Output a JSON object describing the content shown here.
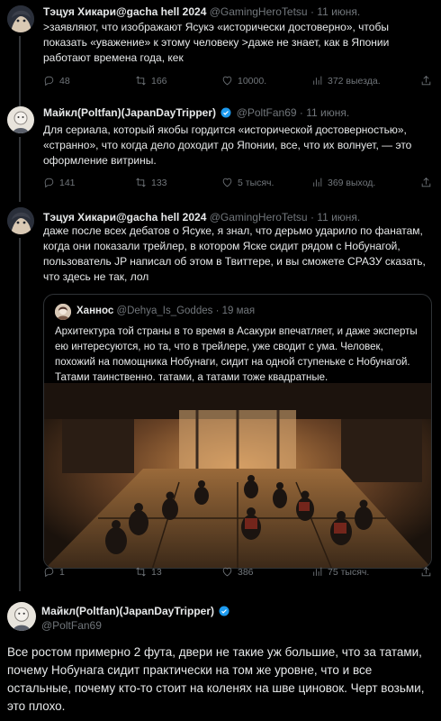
{
  "tweets": [
    {
      "name": "Тэцуя Хикари@gacha hell 2024",
      "handle": "@GamingHeroTetsu",
      "date": "· 11 июня.",
      "text": ">заявляют, что изображают Ясукэ «исторически достоверно», чтобы показать «уважение» к этому человеку >даже не знает, как в Японии работают времена года, кек",
      "replies": "48",
      "retweets": "166",
      "likes": "10000.",
      "views": "372 выезда."
    },
    {
      "name": "Майкл(Poltfan)(JapanDayTripper)",
      "handle": "@PoltFan69",
      "date": "· 11 июня.",
      "text": "Для сериала, который якобы гордится «исторической достоверностью», «странно», что когда дело доходит до Японии, все, что их волнует, — это оформление витрины.",
      "replies": "141",
      "retweets": "133",
      "likes": "5 тысяч.",
      "views": "369 выход."
    },
    {
      "name": "Тэцуя Хикари@gacha hell 2024",
      "handle": "@GamingHeroTetsu",
      "date": "· 11 июня.",
      "text": "даже после всех дебатов о Ясуке, я знал, что дерьмо ударило по фанатам, когда они показали трейлер, в котором Яске сидит рядом с Нобунагой, пользователь JP написал об этом в Твиттере, и вы сможете СРАЗУ сказать, что здесь не так, лол",
      "replies": "1",
      "retweets": "13",
      "likes": "386",
      "views": "75 тысяч."
    }
  ],
  "quote": {
    "name": "Ханнос",
    "handle": "@Dehya_Is_Goddes",
    "date": "· 19 мая",
    "text": "Архитектура той страны в то время в Асакури впечатляет, и даже эксперты ею интересуются, но та, что в трейлере, уже сводит с ума. Человек, похожий на помощника Нобунаги, сидит на одной ступеньке с Нобунагой. Татами таинственно. татами, а татами тоже квадратные."
  },
  "main_tweet": {
    "name": "Майкл(Poltfan)(JapanDayTripper)",
    "handle": "@PoltFan69",
    "text": "Все ростом примерно 2 фута, двери не такие уж большие, что за татами, почему Нобунага сидит практически на том же уровне, что и все остальные, почему кто-то стоит на коленях на шве циновок. Черт возьми, это плохо."
  },
  "colors": {
    "background": "#000000",
    "text": "#e7e9ea",
    "muted": "#71767b",
    "border": "#2f3336",
    "verified": "#1d9bf0"
  }
}
